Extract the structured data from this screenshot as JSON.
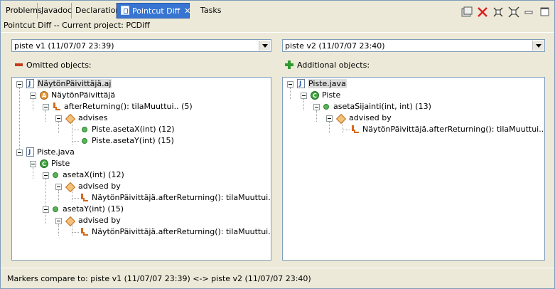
{
  "tabs": [
    {
      "label": "Problems"
    },
    {
      "label": "Javadoc"
    },
    {
      "label": "Declaration"
    },
    {
      "label": "Pointcut Diff"
    },
    {
      "label": "Tasks"
    }
  ],
  "view_header": "Pointcut Diff  --  Current project: PCDiff",
  "left": {
    "combo_value": "piste v1 (11/07/07 23:39)",
    "section_label": "Omitted objects:",
    "tree": [
      {
        "label": "NäytönPäivittäjä.aj"
      },
      {
        "label": "NäytönPäivittäjä"
      },
      {
        "label": "afterReturning(): tilaMuuttui.. (5)"
      },
      {
        "label": "advises"
      },
      {
        "label": "Piste.asetaX(int) (12)"
      },
      {
        "label": "Piste.asetaY(int) (15)"
      },
      {
        "label": "Piste.java"
      },
      {
        "label": "Piste"
      },
      {
        "label": "asetaX(int) (12)"
      },
      {
        "label": "advised by"
      },
      {
        "label": "NäytönPäivittäjä.afterReturning(): tilaMuuttui.. (5)"
      },
      {
        "label": "asetaY(int) (15)"
      },
      {
        "label": "advised by"
      },
      {
        "label": "NäytönPäivittäjä.afterReturning(): tilaMuuttui.. (5)"
      }
    ]
  },
  "right": {
    "combo_value": "piste v2 (11/07/07 23:40)",
    "section_label": "Additional objects:",
    "tree": [
      {
        "label": "Piste.java"
      },
      {
        "label": "Piste"
      },
      {
        "label": "asetaSijainti(int, int) (13)"
      },
      {
        "label": "advised by"
      },
      {
        "label": "NäytönPäivittäjä.afterReturning(): tilaMuuttui.. (5)"
      }
    ]
  },
  "status_text": "Markers compare to: piste v1 (11/07/07 23:39) <-> piste v2 (11/07/07 23:40)",
  "colors": {
    "active_tab": "#3874d1",
    "background": "#ece9d8"
  }
}
